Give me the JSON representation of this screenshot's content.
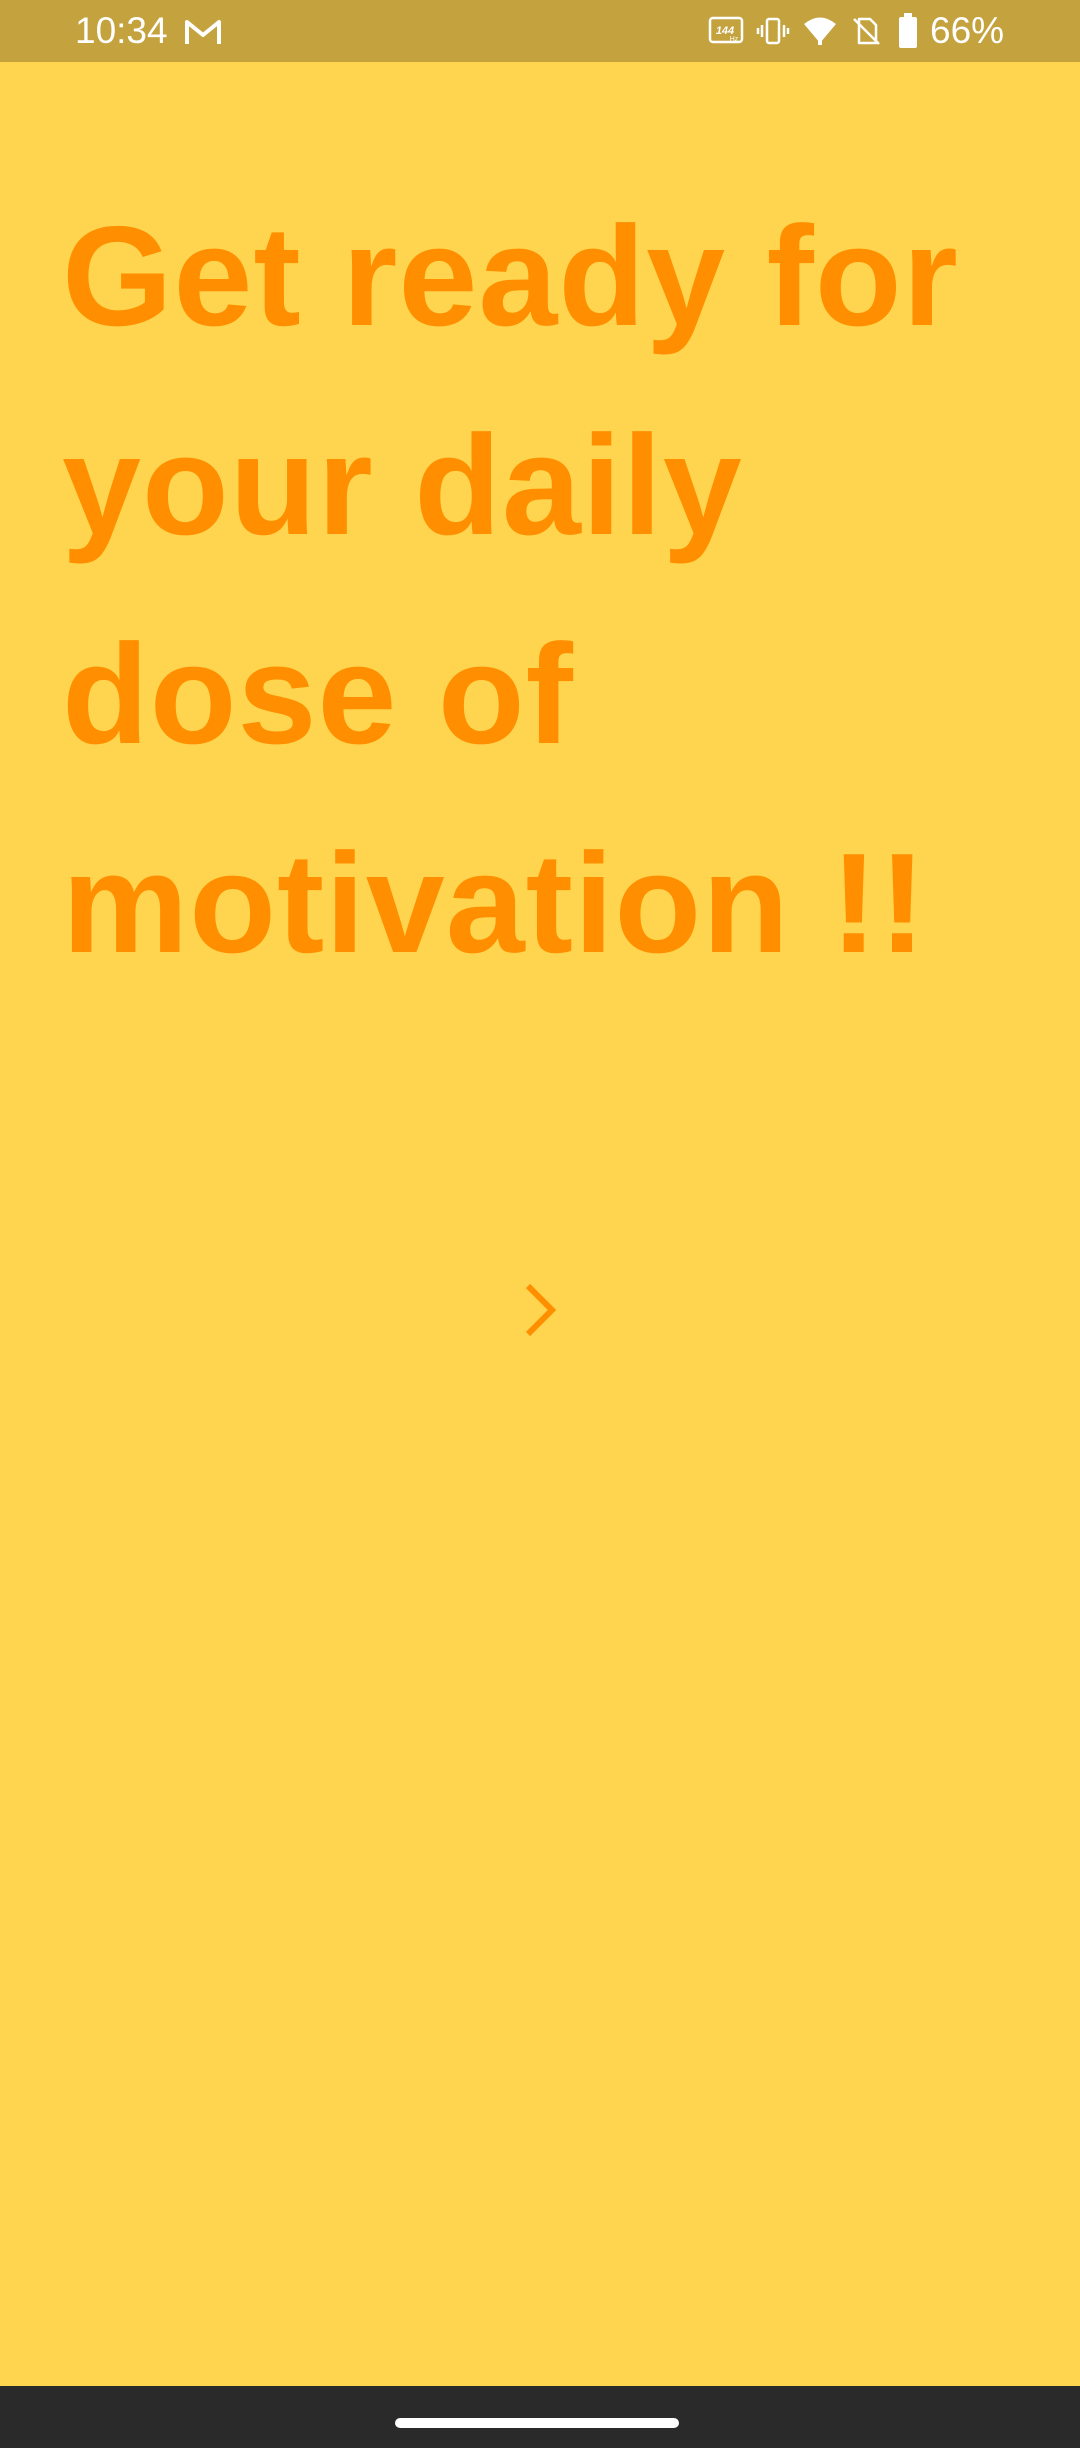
{
  "status_bar": {
    "time": "10:34",
    "battery": "66%",
    "background": "#C4A23E",
    "icons_left": [
      "gmail-icon"
    ],
    "icons_right": [
      "refresh-rate-144hz-icon",
      "vibrate-icon",
      "wifi-icon",
      "no-sim-icon",
      "battery-icon"
    ],
    "refresh_rate_label": "144"
  },
  "main": {
    "headline_lines": [
      "Get ready for",
      "your daily",
      "dose of",
      "motivation !!"
    ],
    "next_icon": "chevron-right-icon"
  },
  "colors": {
    "background": "#FFD54F",
    "accent": "#FF8F00",
    "nav_bar": "#2A2A2A"
  }
}
